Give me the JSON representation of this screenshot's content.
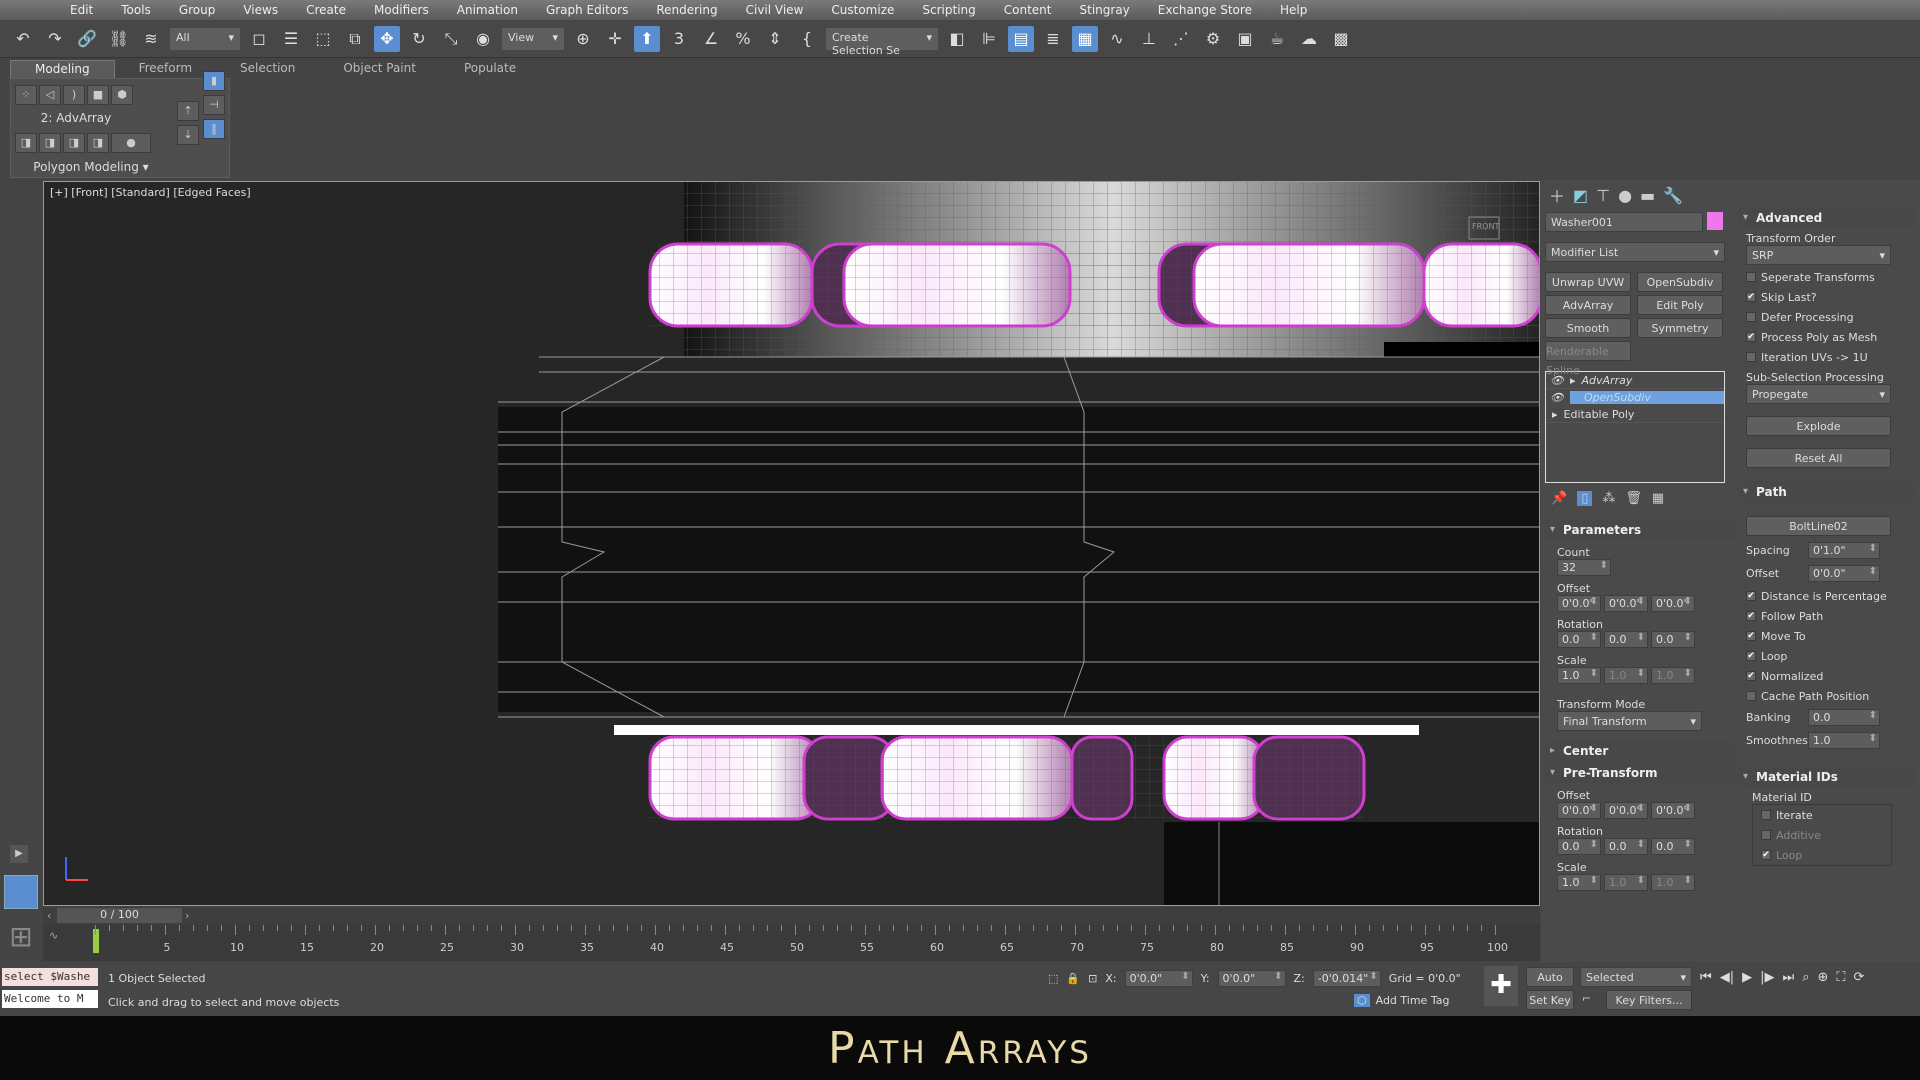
{
  "menu": [
    "Edit",
    "Tools",
    "Group",
    "Views",
    "Create",
    "Modifiers",
    "Animation",
    "Graph Editors",
    "Rendering",
    "Civil View",
    "Customize",
    "Scripting",
    "Content",
    "Stingray",
    "Exchange Store",
    "Help"
  ],
  "toolbar": {
    "filter": "All",
    "ref_coord": "View",
    "selection_set": "Create Selection Se"
  },
  "ribbon": {
    "tabs": [
      "Modeling",
      "Freeform",
      "Selection",
      "Object Paint",
      "Populate"
    ],
    "level": "2: AdvArray",
    "panel": "Polygon Modeling"
  },
  "viewport": {
    "label": "[+] [Front] [Standard] [Edged Faces]",
    "gizmo": "FRONT"
  },
  "colors": {
    "accent": "#5a8ed0",
    "object": "#ee77ee",
    "wire": "#d040d0"
  },
  "command": {
    "object_name": "Washer001",
    "modifier_list": "Modifier List",
    "mod_buttons": [
      "Unwrap UVW",
      "OpenSubdiv",
      "AdvArray",
      "Edit Poly",
      "Smooth",
      "Symmetry",
      "Renderable Spline"
    ],
    "stack": [
      "AdvArray",
      "OpenSubdiv",
      "Editable Poly"
    ],
    "parameters": {
      "title": "Parameters",
      "count_label": "Count",
      "count": "32",
      "offset_label": "Offset",
      "offset": [
        "0'0.0'",
        "0'0.0'",
        "0'0.0'"
      ],
      "rotation_label": "Rotation",
      "rotation": [
        "0.0",
        "0.0",
        "0.0"
      ],
      "scale_label": "Scale",
      "scale": [
        "1.0",
        "1.0",
        "1.0"
      ],
      "mode_label": "Transform Mode",
      "mode": "Final Transform"
    },
    "center": {
      "title": "Center"
    },
    "pre": {
      "title": "Pre-Transform",
      "offset_label": "Offset",
      "offset": [
        "0'0.0'",
        "0'0.0'",
        "0'0.0'"
      ],
      "rotation_label": "Rotation",
      "rotation": [
        "0.0",
        "0.0",
        "0.0"
      ],
      "scale_label": "Scale",
      "scale": [
        "1.0",
        "1.0",
        "1.0"
      ]
    },
    "advanced": {
      "title": "Advanced",
      "order_label": "Transform Order",
      "order": "SRP",
      "checks": [
        {
          "label": "Seperate Transforms",
          "checked": false
        },
        {
          "label": "Skip Last?",
          "checked": true
        },
        {
          "label": "Defer Processing",
          "checked": false
        },
        {
          "label": "Process Poly as Mesh",
          "checked": true
        },
        {
          "label": "Iteration UVs -> 1U",
          "checked": false
        }
      ],
      "sub_label": "Sub-Selection Processing",
      "sub": "Propegate",
      "explode": "Explode",
      "reset": "Reset All"
    },
    "path": {
      "title": "Path",
      "path_object": "BoltLine02",
      "spacing_label": "Spacing",
      "spacing": "0'1.0\"",
      "offset_label": "Offset",
      "offset": "0'0.0\"",
      "checks": [
        {
          "label": "Distance is Percentage",
          "checked": true
        },
        {
          "label": "Follow Path",
          "checked": true
        },
        {
          "label": "Move To",
          "checked": true
        },
        {
          "label": "Loop",
          "checked": true
        },
        {
          "label": "Normalized",
          "checked": true
        },
        {
          "label": "Cache Path Position",
          "checked": false
        }
      ],
      "banking_label": "Banking",
      "banking": "0.0",
      "smooth_label": "Smoothness",
      "smooth": "1.0"
    },
    "matid": {
      "title": "Material IDs",
      "group": "Material ID",
      "checks": [
        {
          "label": "Iterate",
          "checked": false
        },
        {
          "label": "Additive",
          "checked": false
        },
        {
          "label": "Loop",
          "checked": true
        }
      ]
    }
  },
  "timeline": {
    "frame": "0 / 100",
    "ticks": [
      "5",
      "10",
      "15",
      "20",
      "25",
      "30",
      "35",
      "40",
      "45",
      "50",
      "55",
      "60",
      "65",
      "70",
      "75",
      "80",
      "85",
      "90",
      "95",
      "100"
    ]
  },
  "status": {
    "script1": "select $Washe",
    "script2": "Welcome to M",
    "selected": "1 Object Selected",
    "prompt": "Click and drag to select and move objects",
    "x": "0'0.0\"",
    "y": "0'0.0\"",
    "z": "-0'0.014\"",
    "grid": "Grid = 0'0.0\"",
    "add_time_tag": "Add Time Tag",
    "auto_key": "Auto Key",
    "set_key": "Set Key",
    "key_mode": "Selected",
    "key_filters": "Key Filters..."
  },
  "caption": "Path Arrays"
}
